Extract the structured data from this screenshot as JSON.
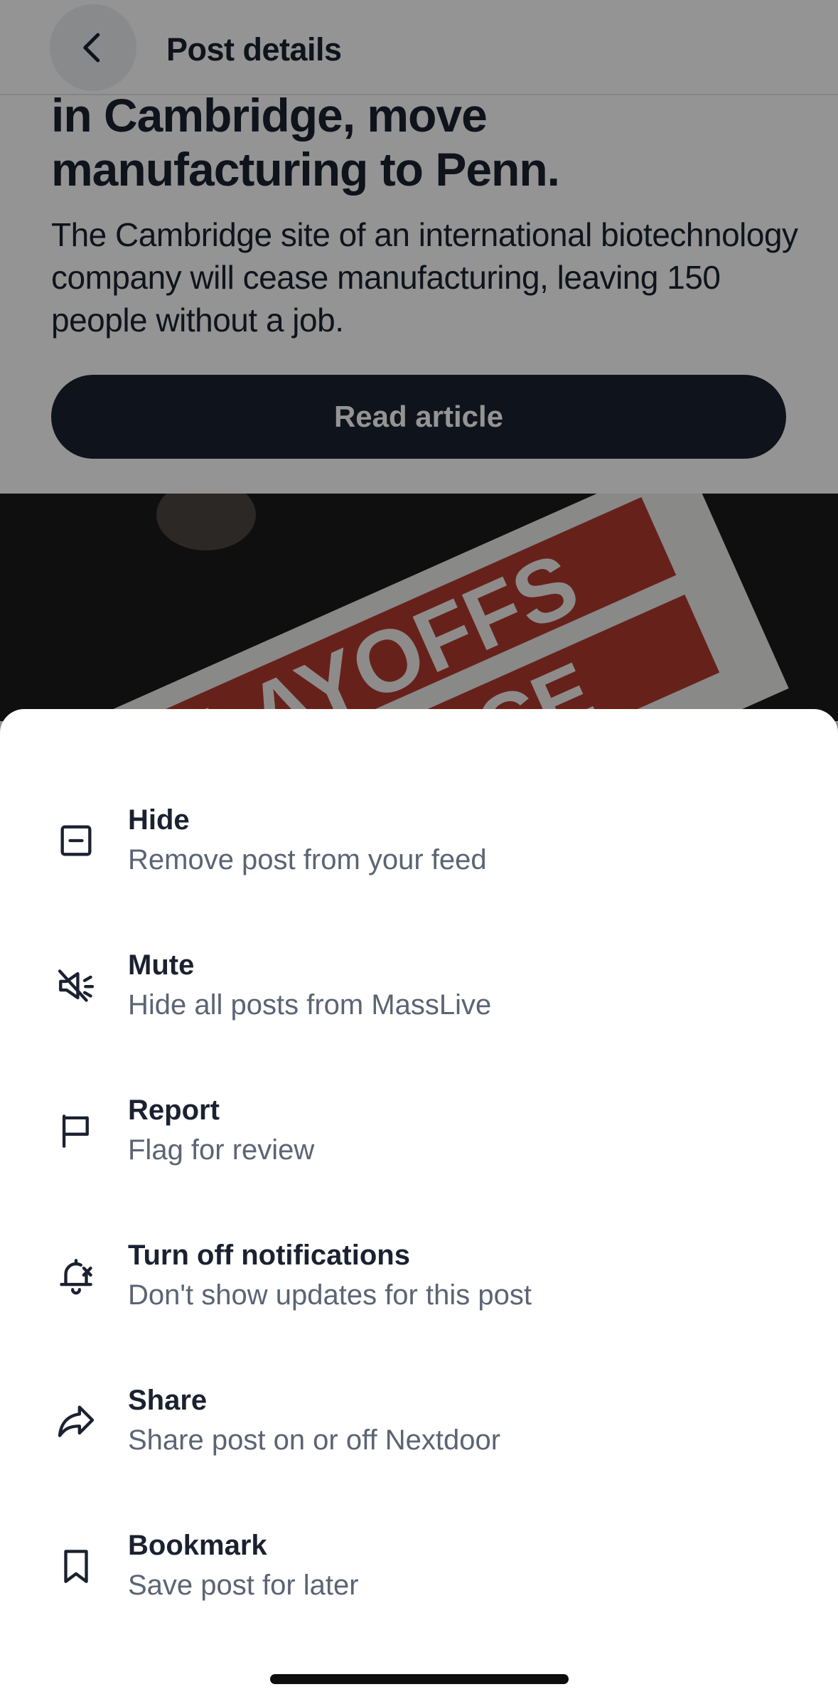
{
  "header": {
    "title": "Post details",
    "back_icon": "chevron-left-icon"
  },
  "article": {
    "headline": "in Cambridge, move manufacturing to Penn.",
    "summary": "The Cambridge site of an international biotechnology company will cease manufacturing, leaving 150 people without a job.",
    "read_button": "Read article",
    "image_text_top": "LAYOFFS",
    "image_text_bottom": "NOTICE"
  },
  "sheet": {
    "items": [
      {
        "icon": "minus-square-icon",
        "title": "Hide",
        "subtitle": "Remove post from your feed"
      },
      {
        "icon": "speaker-muted-icon",
        "title": "Mute",
        "subtitle": "Hide all posts from MassLive"
      },
      {
        "icon": "flag-icon",
        "title": "Report",
        "subtitle": "Flag for review"
      },
      {
        "icon": "bell-off-icon",
        "title": "Turn off notifications",
        "subtitle": "Don't show updates for this post"
      },
      {
        "icon": "share-arrow-icon",
        "title": "Share",
        "subtitle": "Share post on or off Nextdoor"
      },
      {
        "icon": "bookmark-icon",
        "title": "Bookmark",
        "subtitle": "Save post for later"
      }
    ]
  },
  "colors": {
    "text_primary": "#1b2130",
    "text_secondary": "#5b6474",
    "scrim": "rgba(0,0,0,0.42)"
  }
}
